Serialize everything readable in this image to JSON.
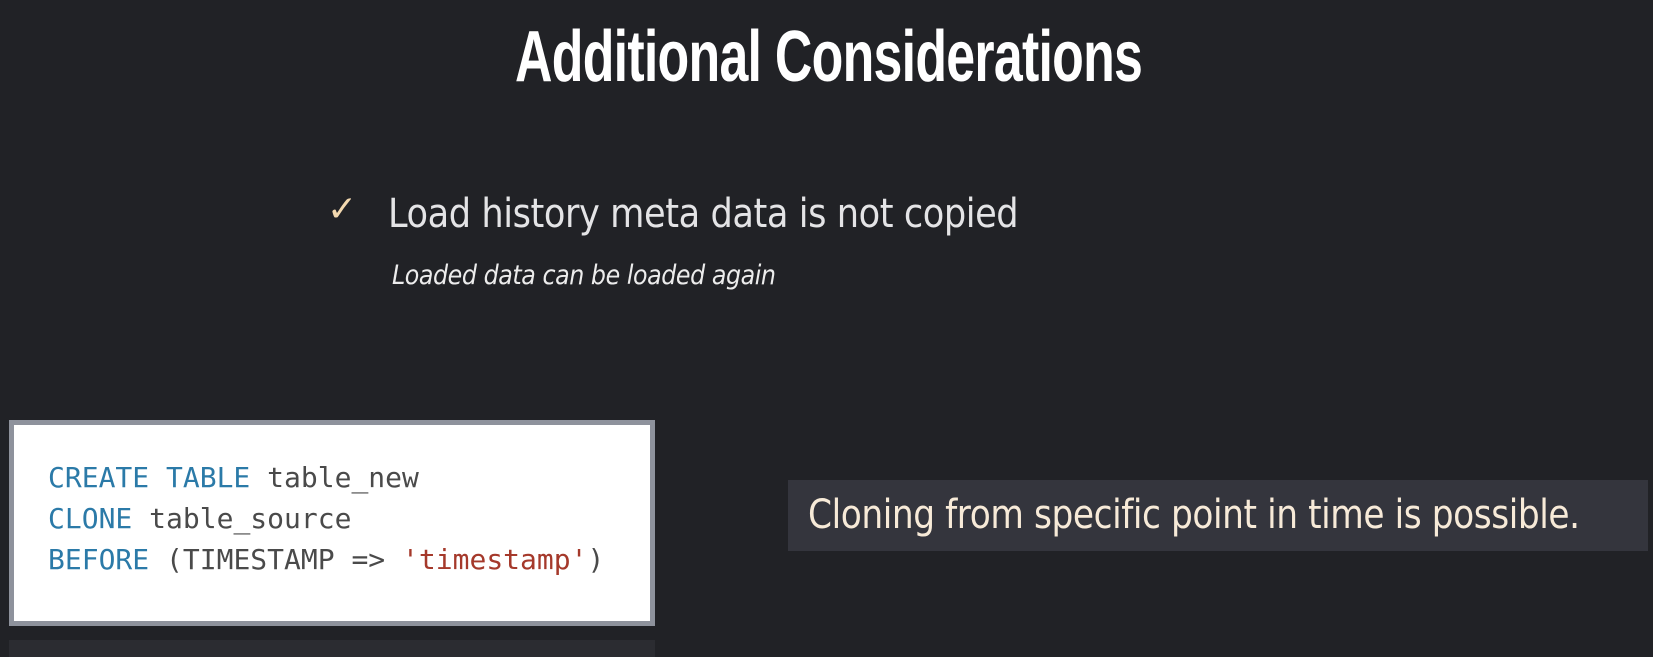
{
  "slide": {
    "title": "Additional Considerations",
    "bullet": {
      "icon": "checkmark-icon",
      "check_glyph": "✓",
      "text": "Load history meta data is not copied",
      "subtext": "Loaded data can be loaded again"
    },
    "code": {
      "line1_kw": "CREATE TABLE",
      "line1_rest": " table_new",
      "line2_kw": "CLONE",
      "line2_rest": " table_source",
      "line3_kw": "BEFORE",
      "line3_mid": " (TIMESTAMP => ",
      "line3_str": "'timestamp'",
      "line3_end": ")"
    },
    "callout": "Cloning from specific point in time is possible."
  },
  "colors": {
    "background": "#212226",
    "keyword": "#2b7aa8",
    "string": "#a5392b",
    "check": "#f3d9b0"
  }
}
